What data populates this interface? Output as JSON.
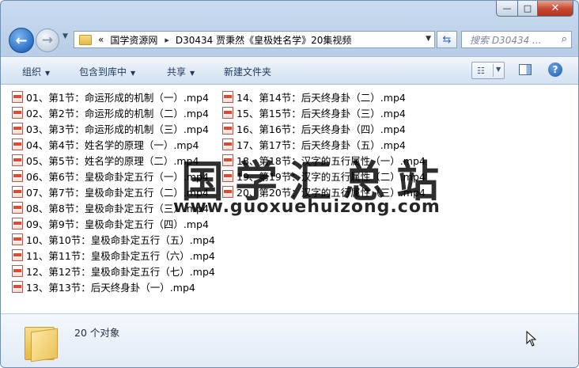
{
  "window": {
    "buttons": {
      "minimize": "—",
      "maximize": "□",
      "close": "✕"
    }
  },
  "nav": {
    "back_icon": "back-arrow-icon",
    "forward_icon": "forward-arrow-icon",
    "address": {
      "prefix": "«",
      "segments": [
        "国学资源网",
        "D30434 贾秉然《皇极姓名学》20集视频"
      ]
    },
    "search_placeholder": "搜索 D30434 ..."
  },
  "toolbar": {
    "organize": "组织",
    "include_in_library": "包含到库中",
    "share": "共享",
    "new_folder": "新建文件夹"
  },
  "files_col1": [
    "01、第1节：命运形成的机制（一）.mp4",
    "02、第2节：命运形成的机制（二）.mp4",
    "03、第3节：命运形成的机制（三）.mp4",
    "04、第4节：姓名学的原理（一）.mp4",
    "05、第5节：姓名学的原理（二）.mp4",
    "06、第6节：皇极命卦定五行（一）.mp4",
    "07、第7节：皇极命卦定五行（二）.mp4",
    "08、第8节：皇极命卦定五行（三）.mp4",
    "09、第9节：皇极命卦定五行（四）.mp4",
    "10、第10节：皇极命卦定五行（五）.mp4",
    "11、第11节：皇极命卦定五行（六）.mp4",
    "12、第12节：皇极命卦定五行（七）.mp4",
    "13、第13节：后天终身卦（一）.mp4"
  ],
  "files_col2": [
    "14、第14节：后天终身卦（二）.mp4",
    "15、第15节：后天终身卦（三）.mp4",
    "16、第16节：后天终身卦（四）.mp4",
    "17、第17节：后天终身卦（五）.mp4",
    "18、第18节：汉字的五行属性（一）.mp4",
    "19、第19节：汉字的五行属性（二）.mp4",
    "20、第20节：汉字的五行属性（三）.mp4"
  ],
  "watermark": {
    "title": "国学汇总站",
    "url": "www.guoxuehuizong.com"
  },
  "details": {
    "count": "20 个对象"
  }
}
